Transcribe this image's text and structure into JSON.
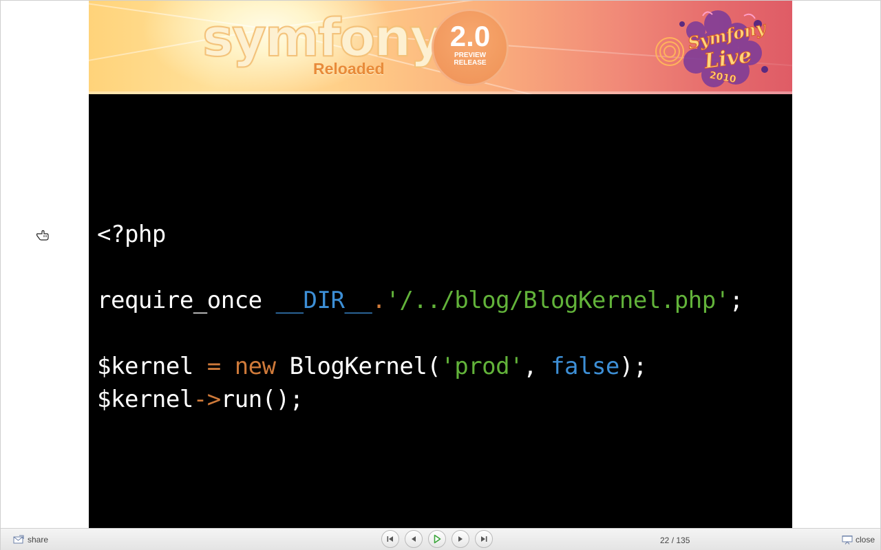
{
  "slide": {
    "banner": {
      "logo_text": "symfony",
      "logo_subtitle": "Reloaded",
      "version_number": "2.0",
      "version_line1": "PREVIEW",
      "version_line2": "RELEASE",
      "event_logo_text": "Symfony Live 2010"
    },
    "code_lines": [
      "<?php",
      "",
      "require_once __DIR__.'/../blog/BlogKernel.php';",
      "",
      "$kernel = new BlogKernel('prod', false);",
      "$kernel->run();"
    ],
    "colors": {
      "background": "#000000",
      "text": "#ffffff",
      "keyword": "#cf7a3a",
      "constant": "#3d8fd6",
      "string": "#62b33a"
    }
  },
  "toolbar": {
    "share_label": "share",
    "current_page": "22",
    "total_pages": "135",
    "page_separator": " / ",
    "close_label": "close",
    "icons": {
      "share": "share-envelope-icon",
      "first": "skip-to-first-icon",
      "prev": "previous-icon",
      "play": "play-icon",
      "next": "next-icon",
      "last": "skip-to-last-icon",
      "close": "presentation-screen-icon"
    }
  }
}
